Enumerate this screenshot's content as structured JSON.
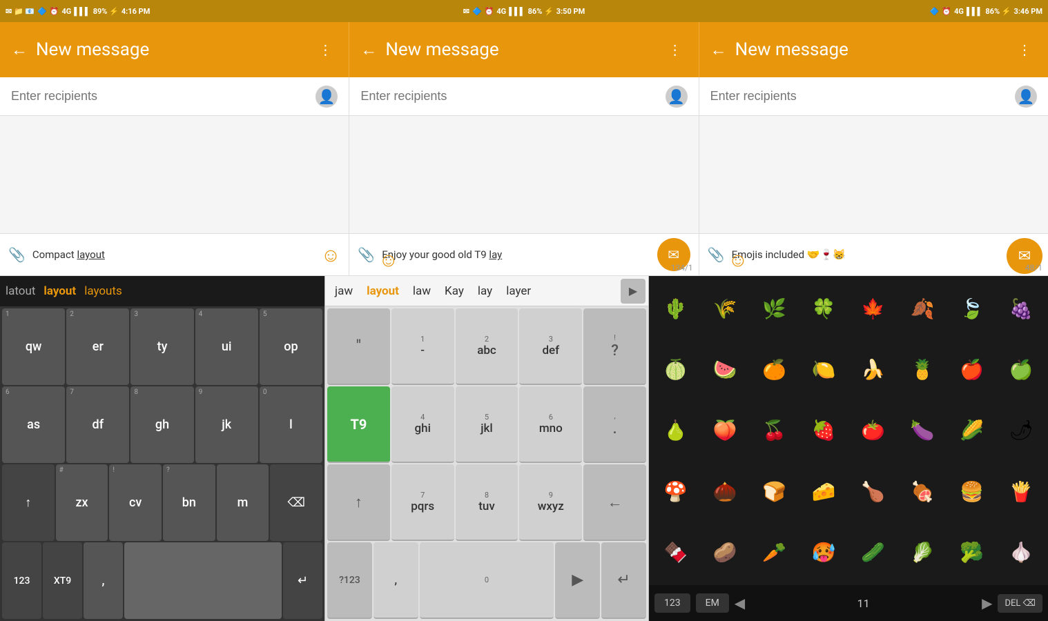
{
  "screens": [
    {
      "id": "screen1",
      "status": {
        "icons_left": "✉ 📁 📧",
        "bluetooth": "⚡",
        "alarm": "⏰",
        "network": "4G",
        "battery": "89%",
        "time": "4:16 PM"
      },
      "title": "New message",
      "recipient_placeholder": "Enter recipients",
      "keyboard_hint": "Compact layout",
      "keyboard_hint_underline": "layout",
      "char_count": "",
      "suggestions": [
        "latout",
        "layout",
        "layouts"
      ]
    },
    {
      "id": "screen2",
      "status": {
        "bluetooth": "⚡",
        "alarm": "⏰",
        "network": "4G",
        "battery": "86%",
        "time": "3:50 PM"
      },
      "title": "New message",
      "recipient_placeholder": "Enter recipients",
      "keyboard_hint": "Enjoy your good old T9 lay",
      "keyboard_hint_underline": "lay",
      "char_count": "134/1",
      "t9_words": [
        "jaw",
        "layout",
        "law",
        "Kay",
        "lay",
        "layer"
      ]
    },
    {
      "id": "screen3",
      "status": {
        "bluetooth": "⚡",
        "alarm": "⏰",
        "network": "4G",
        "battery": "86%",
        "time": "3:46 PM"
      },
      "title": "New message",
      "recipient_placeholder": "Enter recipients",
      "keyboard_hint": "Emojis included 🤝🍷😸",
      "char_count": "48/1",
      "emoji_bottom": {
        "num_label": "123",
        "em_label": "EM",
        "page_num": "11",
        "del_label": "DEL"
      }
    }
  ],
  "keyboard": {
    "rows": [
      [
        "qw",
        "er",
        "ty",
        "ui",
        "op"
      ],
      [
        "as",
        "df",
        "gh",
        "jk",
        "l"
      ],
      [
        "zx",
        "cv",
        "bn",
        "m",
        "⌫"
      ],
      [
        "123",
        "XT9",
        ",",
        "space",
        "↵"
      ]
    ],
    "row_nums": [
      [
        "1",
        "2",
        "3",
        "4",
        "5"
      ],
      [
        "6",
        "7",
        "8",
        "9",
        "0"
      ],
      [
        "↑",
        "#",
        "!",
        "?",
        ""
      ],
      [
        "",
        "",
        "",
        "",
        ""
      ]
    ],
    "t9_keys": [
      [
        {
          "num": "",
          "letters": "\""
        },
        {
          "num": "1",
          "letters": "-"
        },
        {
          "num": "2",
          "letters": "abc"
        },
        {
          "num": "3",
          "letters": "def"
        },
        {
          "num": "!",
          "letters": "?"
        }
      ],
      [
        {
          "num": "",
          "letters": "T9",
          "active": true
        },
        {
          "num": "4",
          "letters": "ghi"
        },
        {
          "num": "5",
          "letters": "jkl"
        },
        {
          "num": "6",
          "letters": "mno"
        },
        {
          "num": ",",
          "letters": "."
        }
      ],
      [
        {
          "num": "",
          "letters": "↑"
        },
        {
          "num": "7",
          "letters": "pqrs"
        },
        {
          "num": "8",
          "letters": "tuv"
        },
        {
          "num": "9",
          "letters": "wxyz"
        },
        {
          "num": "",
          "letters": "←"
        }
      ],
      [
        {
          "num": "",
          "letters": "?123"
        },
        {
          "num": "",
          "letters": ","
        },
        {
          "num": "0",
          "letters": "___"
        },
        {
          "num": "",
          "letters": "▶"
        },
        {
          "num": "",
          "letters": "↵"
        }
      ]
    ],
    "emojis": [
      "🌵",
      "🌾",
      "🌿",
      "🍀",
      "🍁",
      "🍂",
      "🍃",
      "🍇",
      "🍈",
      "🍉",
      "🍊",
      "🍋",
      "🍌",
      "🍍",
      "🍎",
      "🍏",
      "🍐",
      "🍑",
      "🍒",
      "🍓",
      "🍅",
      "🍆",
      "🌽",
      "🌶",
      "🍄",
      "🍫",
      "🍞",
      "🧀",
      "🍗",
      "🍖",
      "🍔",
      "🍟"
    ]
  },
  "colors": {
    "orange": "#e8960c",
    "dark_orange": "#b8860b",
    "green": "#4caf50"
  }
}
